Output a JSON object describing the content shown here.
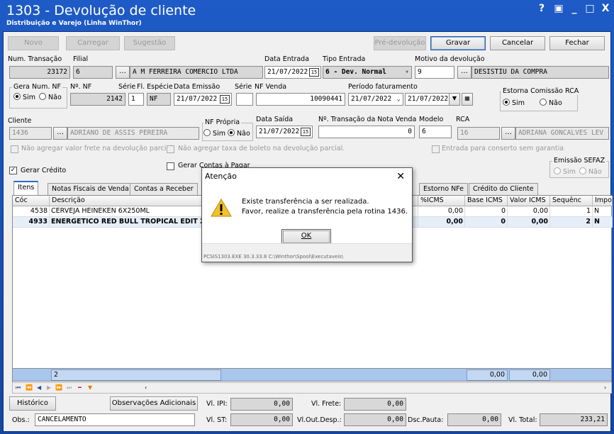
{
  "window": {
    "title": "1303 - Devolução de cliente",
    "subtitle": "Distribuição e Varejo (Linha WinThor)",
    "controls": [
      "?",
      "▣",
      "_",
      "□",
      "X"
    ]
  },
  "toolbar": {
    "novo": "Novo",
    "carregar": "Carregar",
    "sugestao": "Sugestão",
    "pre_devolucao": "Pré-devolução",
    "gravar": "Gravar",
    "cancelar": "Cancelar",
    "fechar": "Fechar"
  },
  "row1": {
    "num_transacao_label": "Num. Transação",
    "num_transacao": "23172",
    "filial_label": "Filial",
    "filial": "6",
    "filial_nome": "A M FERREIRA COMERCIO LTDA",
    "data_entrada_label": "Data Entrada",
    "data_entrada": "21/07/2022",
    "tipo_entrada_label": "Tipo Entrada",
    "tipo_entrada": "6 - Dev. Normal",
    "motivo_label": "Motivo da devolução",
    "motivo_cod": "9",
    "motivo_desc": "DESISTIU DA COMPRA"
  },
  "row2": {
    "gera_num_nf_label": "Gera Num. NF",
    "sim": "Sim",
    "nao": "Não",
    "num_nf_label": "Nº. NF",
    "num_nf": "2142",
    "serie_label": "Série",
    "serie": "1",
    "especie_label": "Fl. Espécie",
    "especie": "NF",
    "data_emissao_label": "Data Emissão",
    "data_emissao": "21/07/2022",
    "serie2_label": "Série",
    "serie2": "",
    "nf_venda_label": "NF Venda",
    "nf_venda": "10090441",
    "periodo_label": "Período faturamento",
    "periodo_ini": "21/07/2022",
    "periodo_fim": "21/07/2022",
    "estorna_label": "Estorna Comissão RCA",
    "estorna_sim": "Sim",
    "estorna_nao": "Não"
  },
  "row3": {
    "cliente_label": "Cliente",
    "cliente_cod": "1436",
    "cliente_nome": "ADRIANO DE ASSIS PEREIRA",
    "nf_propria_label": "NF Própria",
    "nf_sim": "Sim",
    "nf_nao": "Não",
    "data_saida_label": "Data Saída",
    "data_saida": "21/07/2022",
    "transacao_venda_label": "Nº. Transação da Nota Venda",
    "transacao_venda": "0",
    "modelo_label": "Modelo",
    "modelo": "6",
    "rca_label": "RCA",
    "rca_cod": "16",
    "rca_nome": "ADRIANA GONCALVES LEV"
  },
  "checks": {
    "nao_agregar_frete": "Não agregar valor frete na devolução parcial",
    "nao_agregar_boleto": "Não agregar taxa de boleto na devolução parcial.",
    "entrada_conserto": "Entrada para conserto sem garantia",
    "gerar_credito": "Gerar Crédito",
    "gerar_contas": "Gerar Contas à Pagar",
    "emissao_sefaz": "Emissão SEFAZ",
    "sefaz_sim": "Sim",
    "sefaz_nao": "Não"
  },
  "tabs": [
    "Itens",
    "Notas Fiscais de Venda",
    "Contas a Receber",
    "Estorno NFe",
    "Crédito do Cliente"
  ],
  "grid": {
    "headers": [
      "Cóc",
      "Descrição",
      "%ICMS",
      "Base ICMS",
      "Valor ICMS",
      "Sequênc",
      "Impo"
    ],
    "rows": [
      {
        "cod": "4538",
        "desc": "CERVEJA HEINEKEN 6X250ML",
        "icms": "0,00",
        "base": "0",
        "valor": "0,00",
        "seq": "1",
        "imp": "N"
      },
      {
        "cod": "4933",
        "desc": "ENERGETICO RED BULL TROPICAL EDIT 25",
        "icms": "0,00",
        "base": "0",
        "valor": "0,00",
        "seq": "2",
        "imp": "N"
      }
    ],
    "footer_count": "2",
    "footer_base": "0,00",
    "footer_valor": "0,00"
  },
  "bottom": {
    "historico": "Histórico",
    "observacoes": "Observações Adicionais",
    "vl_ipi_label": "Vl. IPI:",
    "vl_ipi": "0,00",
    "vl_frete_label": "Vl. Frete:",
    "vl_frete": "0,00",
    "obs_label": "Obs.:",
    "obs": "CANCELAMENTO",
    "vl_st_label": "Vl. ST:",
    "vl_st": "0,00",
    "vl_out_label": "Vl.Out.Desp.:",
    "vl_out": "0,00",
    "dsc_pauta_label": "Dsc.Pauta:",
    "dsc_pauta": "0,00",
    "vl_total_label": "Vl. Total:",
    "vl_total": "233,21"
  },
  "dialog": {
    "title": "Atenção",
    "line1": "Existe transferência a ser realizada.",
    "line2": "Favor, realize a transferência pela rotina 1436.",
    "ok": "OK",
    "status": "PCSIS1303.EXE 30.3.33.8 C:\\Winthor\\Spool\\Executaveis\\"
  }
}
